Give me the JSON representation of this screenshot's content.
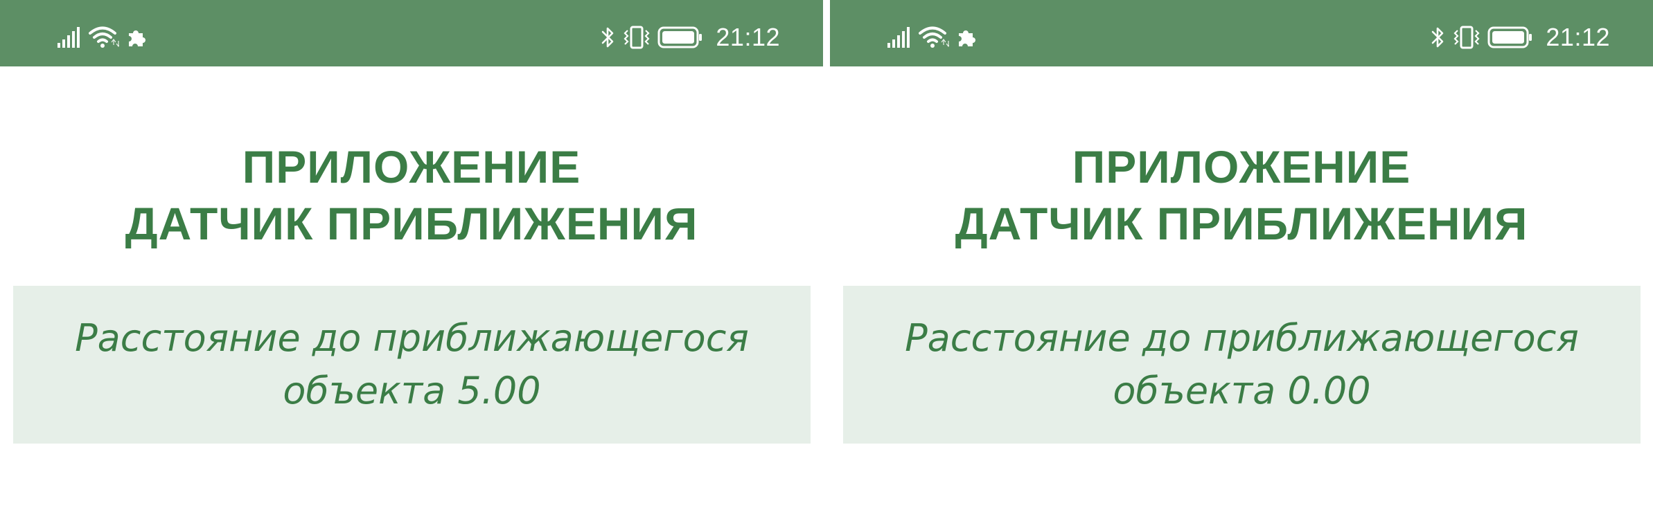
{
  "theme": {
    "status_bar_color": "#5d8f65",
    "accent_color": "#3b7d46",
    "card_background": "#e6efe8"
  },
  "screens": [
    {
      "status_bar": {
        "left_icons": [
          "signal-icon",
          "wifi-icon",
          "puzzle-icon"
        ],
        "right_icons": [
          "bluetooth-icon",
          "vibrate-icon",
          "battery-icon"
        ],
        "time": "21:12"
      },
      "title_line1": "ПРИЛОЖЕНИЕ",
      "title_line2": "ДАТЧИК ПРИБЛИЖЕНИЯ",
      "distance_line1": "Расстояние до приближающегося",
      "distance_line2": "объекта 5.00"
    },
    {
      "status_bar": {
        "left_icons": [
          "signal-icon",
          "wifi-icon",
          "puzzle-icon"
        ],
        "right_icons": [
          "bluetooth-icon",
          "vibrate-icon",
          "battery-icon"
        ],
        "time": "21:12"
      },
      "title_line1": "ПРИЛОЖЕНИЕ",
      "title_line2": "ДАТЧИК ПРИБЛИЖЕНИЯ",
      "distance_line1": "Расстояние до приближающегося",
      "distance_line2": "объекта 0.00"
    }
  ]
}
